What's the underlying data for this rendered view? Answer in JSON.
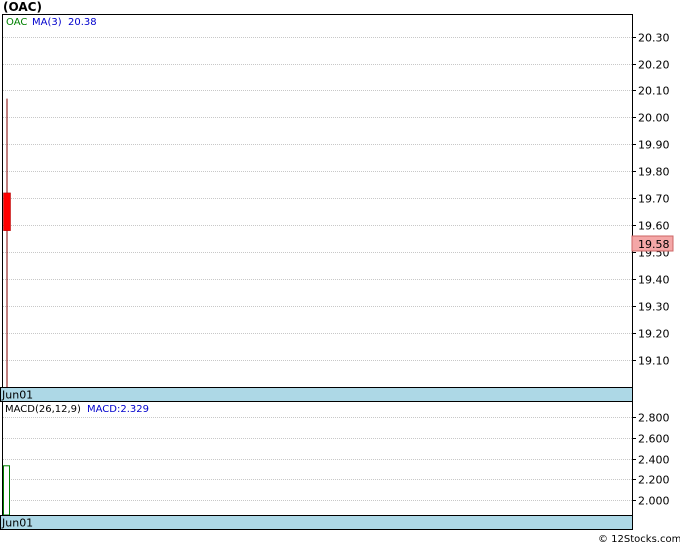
{
  "title": "(OAC)",
  "copyright": "© 12Stocks.com",
  "colors": {
    "grid": "#c8c8c8",
    "axis_band": "#add8e6",
    "candle_down": "#ff0000",
    "wick": "#800000",
    "ticker_text": "#008000",
    "ma_text": "#0000cc",
    "price_badge_bg": "#f4a7a7",
    "macd_bar": "#008000"
  },
  "chart_data": [
    {
      "type": "candlestick",
      "legend": {
        "ticker": "OAC",
        "ma_label": "MA(3)",
        "ma_value": "20.38"
      },
      "x_label": "Jun01",
      "ylim": [
        19.0,
        20.38
      ],
      "yticks": [
        "20.30",
        "20.20",
        "20.10",
        "20.00",
        "19.90",
        "19.80",
        "19.70",
        "19.60",
        "19.50",
        "19.40",
        "19.30",
        "19.20",
        "19.10"
      ],
      "ytick_values": [
        20.3,
        20.2,
        20.1,
        20.0,
        19.9,
        19.8,
        19.7,
        19.6,
        19.5,
        19.4,
        19.3,
        19.2,
        19.1
      ],
      "candles": [
        {
          "date": "Jun01",
          "open": 19.72,
          "high": 20.07,
          "low": 19.0,
          "close": 19.58
        }
      ],
      "last_price": "19.58"
    },
    {
      "type": "bar",
      "legend": {
        "name": "MACD(26,12,9)",
        "value_label": "MACD:2.329"
      },
      "x_label": "Jun01",
      "ylim": [
        1.85,
        2.95
      ],
      "yticks": [
        "2.800",
        "2.600",
        "2.400",
        "2.200",
        "2.000"
      ],
      "ytick_values": [
        2.8,
        2.6,
        2.4,
        2.2,
        2.0
      ],
      "bars": [
        {
          "date": "Jun01",
          "value": 2.329
        }
      ]
    }
  ]
}
